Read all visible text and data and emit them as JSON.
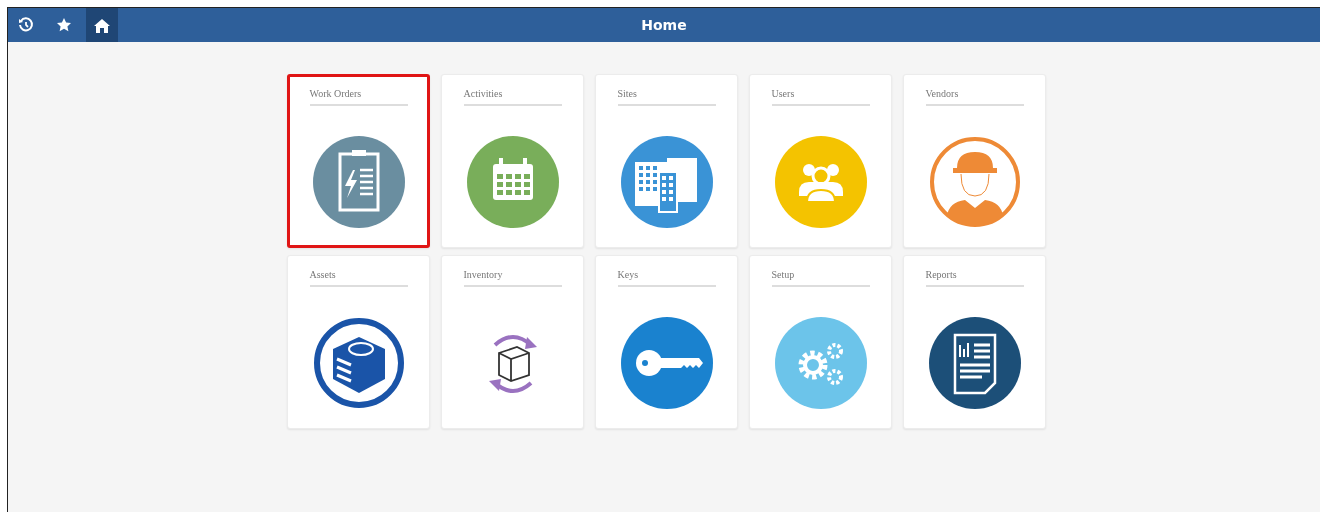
{
  "top_bar": {
    "title": "Home",
    "buttons": [
      {
        "kind": "history",
        "selected": false
      },
      {
        "kind": "star",
        "selected": false
      },
      {
        "kind": "home",
        "selected": true
      }
    ]
  },
  "tiles": [
    {
      "label": "Work Orders",
      "kind": "clipboard",
      "color": "#6a8ea0",
      "selected": true
    },
    {
      "label": "Activities",
      "kind": "calendar",
      "color": "#79ae5a",
      "selected": false
    },
    {
      "label": "Sites",
      "kind": "buildings",
      "color": "#3a93d6",
      "selected": false
    },
    {
      "label": "Users",
      "kind": "people",
      "color": "#f4c300",
      "selected": false
    },
    {
      "label": "Vendors",
      "kind": "worker",
      "color": "#ee8a36",
      "selected": false
    },
    {
      "label": "Assets",
      "kind": "cube",
      "color": "#1a54a8",
      "selected": false
    },
    {
      "label": "Inventory",
      "kind": "box",
      "color": "#9a72c0",
      "selected": false
    },
    {
      "label": "Keys",
      "kind": "key",
      "color": "#1a82cf",
      "selected": false
    },
    {
      "label": "Setup",
      "kind": "gears",
      "color": "#6cc4ea",
      "selected": false
    },
    {
      "label": "Reports",
      "kind": "report",
      "color": "#1c4f78",
      "selected": false
    }
  ]
}
